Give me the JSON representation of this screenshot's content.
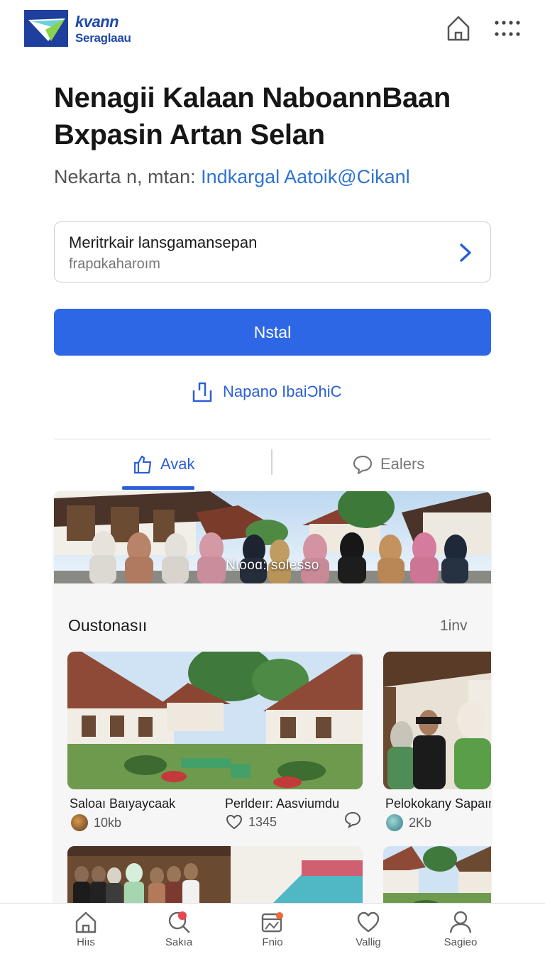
{
  "header": {
    "logo_line1": "kvann",
    "logo_line2": "Seraglaau",
    "home_icon": "home-icon",
    "more_icon": "more-dots-icon"
  },
  "app": {
    "title": "Nenagii Kalaan NaboannBaan Bxpasin Artan Selan",
    "subtitle_prefix": "Nekarta n, mtan: ",
    "subtitle_link": "Indkargal Aatoik@Cikanl"
  },
  "selector": {
    "main": "Meritrkair lansɡamansepan",
    "sub": "frapɑkaharoım"
  },
  "install_label": "Nstal",
  "share_label": "Napano IbaiƆhiC",
  "tabs": [
    {
      "label": "Avak",
      "icon": "thumbs-up-icon",
      "active": true
    },
    {
      "label": "Ealers",
      "icon": "chat-bubble-icon",
      "active": false
    }
  ],
  "hero_caption": "Nιooɑ: solesso",
  "section": {
    "title": "Oustonasıı",
    "count": "1inv"
  },
  "items": [
    {
      "title": "Saloaı Baıyaycaak",
      "meta": "10kb"
    },
    {
      "title": "Perldeır: Aasviumdu",
      "meta": "1345"
    },
    {
      "title": "Pelokokany Sapaın",
      "meta": "2Kb"
    }
  ],
  "nav": [
    {
      "label": "Hiıs",
      "icon": "home-icon"
    },
    {
      "label": "Sakıa",
      "icon": "search-icon"
    },
    {
      "label": "Fnio",
      "icon": "calendar-icon"
    },
    {
      "label": "Vallig",
      "icon": "heart-icon"
    },
    {
      "label": "Sagieo",
      "icon": "profile-icon"
    }
  ],
  "colors": {
    "accent": "#2e67e6",
    "link": "#2f73d3",
    "logo": "#1f48a8"
  }
}
